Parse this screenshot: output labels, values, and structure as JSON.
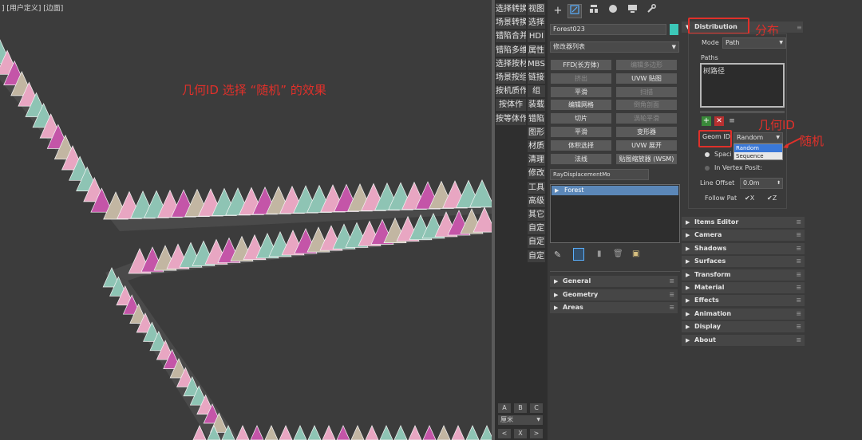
{
  "viewport": {
    "label": "] [用户定义] [边面]",
    "annotation": "几何ID 选择 “随机” 的效果",
    "colors": {
      "background": "#3c3c3c",
      "green": "#8ec4b4",
      "pink": "#e8a6c2",
      "magenta": "#c455a8",
      "tan": "#c2b6a2"
    }
  },
  "command_tabs": [
    [
      "选择转换",
      "视图"
    ],
    [
      "场景转换",
      "选择"
    ],
    [
      "错陷合并",
      "HDI"
    ],
    [
      "错陷多维",
      "属性"
    ],
    [
      "选择按材",
      "MBS"
    ],
    [
      "场景按组",
      "链接"
    ],
    [
      "按机质作",
      "组"
    ],
    [
      "按体作",
      "装载"
    ],
    [
      "按等体作",
      "错陷"
    ],
    [
      "",
      "图形"
    ],
    [
      "",
      "材质"
    ],
    [
      "",
      "清理"
    ],
    [
      "",
      "修改"
    ],
    [
      "",
      "工具"
    ],
    [
      "",
      "高级"
    ],
    [
      "",
      "其它"
    ],
    [
      "",
      "自定"
    ],
    [
      "",
      "自定"
    ],
    [
      "",
      "自定"
    ]
  ],
  "bottom_controls": {
    "abc": [
      "A",
      "B",
      "C"
    ],
    "unit": "厘米",
    "nav": [
      "<",
      "X",
      ">"
    ]
  },
  "modifier_panel": {
    "icon_tabs": [
      "create-icon",
      "modify-icon",
      "hierarchy-icon",
      "motion-icon",
      "display-icon",
      "utilities-icon"
    ],
    "object_name": "Forest023",
    "object_color": "#3cc8b8",
    "modifier_list": "修改器列表",
    "buttons": [
      [
        "FFD(长方体)",
        "编辑多边形"
      ],
      [
        "挤出",
        "UVW 贴图"
      ],
      [
        "平滑",
        "扫描"
      ],
      [
        "编辑网格",
        "倒角剖面"
      ],
      [
        "切片",
        "涡轮平滑"
      ],
      [
        "平滑",
        "变形器"
      ],
      [
        "体积选择",
        "UVW 展开"
      ],
      [
        "法线",
        "贴图缩放器 (WSM)"
      ]
    ],
    "buttons_disabled": [
      [
        false,
        true
      ],
      [
        true,
        false
      ],
      [
        false,
        true
      ],
      [
        false,
        true
      ],
      [
        false,
        true
      ],
      [
        false,
        false
      ],
      [
        false,
        false
      ],
      [
        false,
        false
      ]
    ],
    "extra_field": "RayDisplacementMo",
    "stack_item": "Forest",
    "rollouts": [
      "General",
      "Geometry",
      "Areas"
    ]
  },
  "distribution": {
    "title": "Distribution",
    "title_annotation": "分布",
    "mode_label": "Mode",
    "mode_value": "Path",
    "paths_label": "Paths",
    "paths_item": "树路径",
    "geom_id_label": "Geom ID",
    "geom_id_value": "Random",
    "geom_id_annotation": "几何ID",
    "random_annotation": "随机",
    "dropdown_options": [
      "Random",
      "Sequence"
    ],
    "spacing_label": "Spaci",
    "in_vertex_label": "In Vertex Posit:",
    "line_offset_label": "Line Offset",
    "line_offset_value": "0.0m",
    "follow_label": "Follow Pat",
    "follow_x": "X",
    "follow_z": "Z"
  },
  "right_rollouts": [
    "Items Editor",
    "Camera",
    "Shadows",
    "Surfaces",
    "Transform",
    "Material",
    "Effects",
    "Animation",
    "Display",
    "About"
  ]
}
